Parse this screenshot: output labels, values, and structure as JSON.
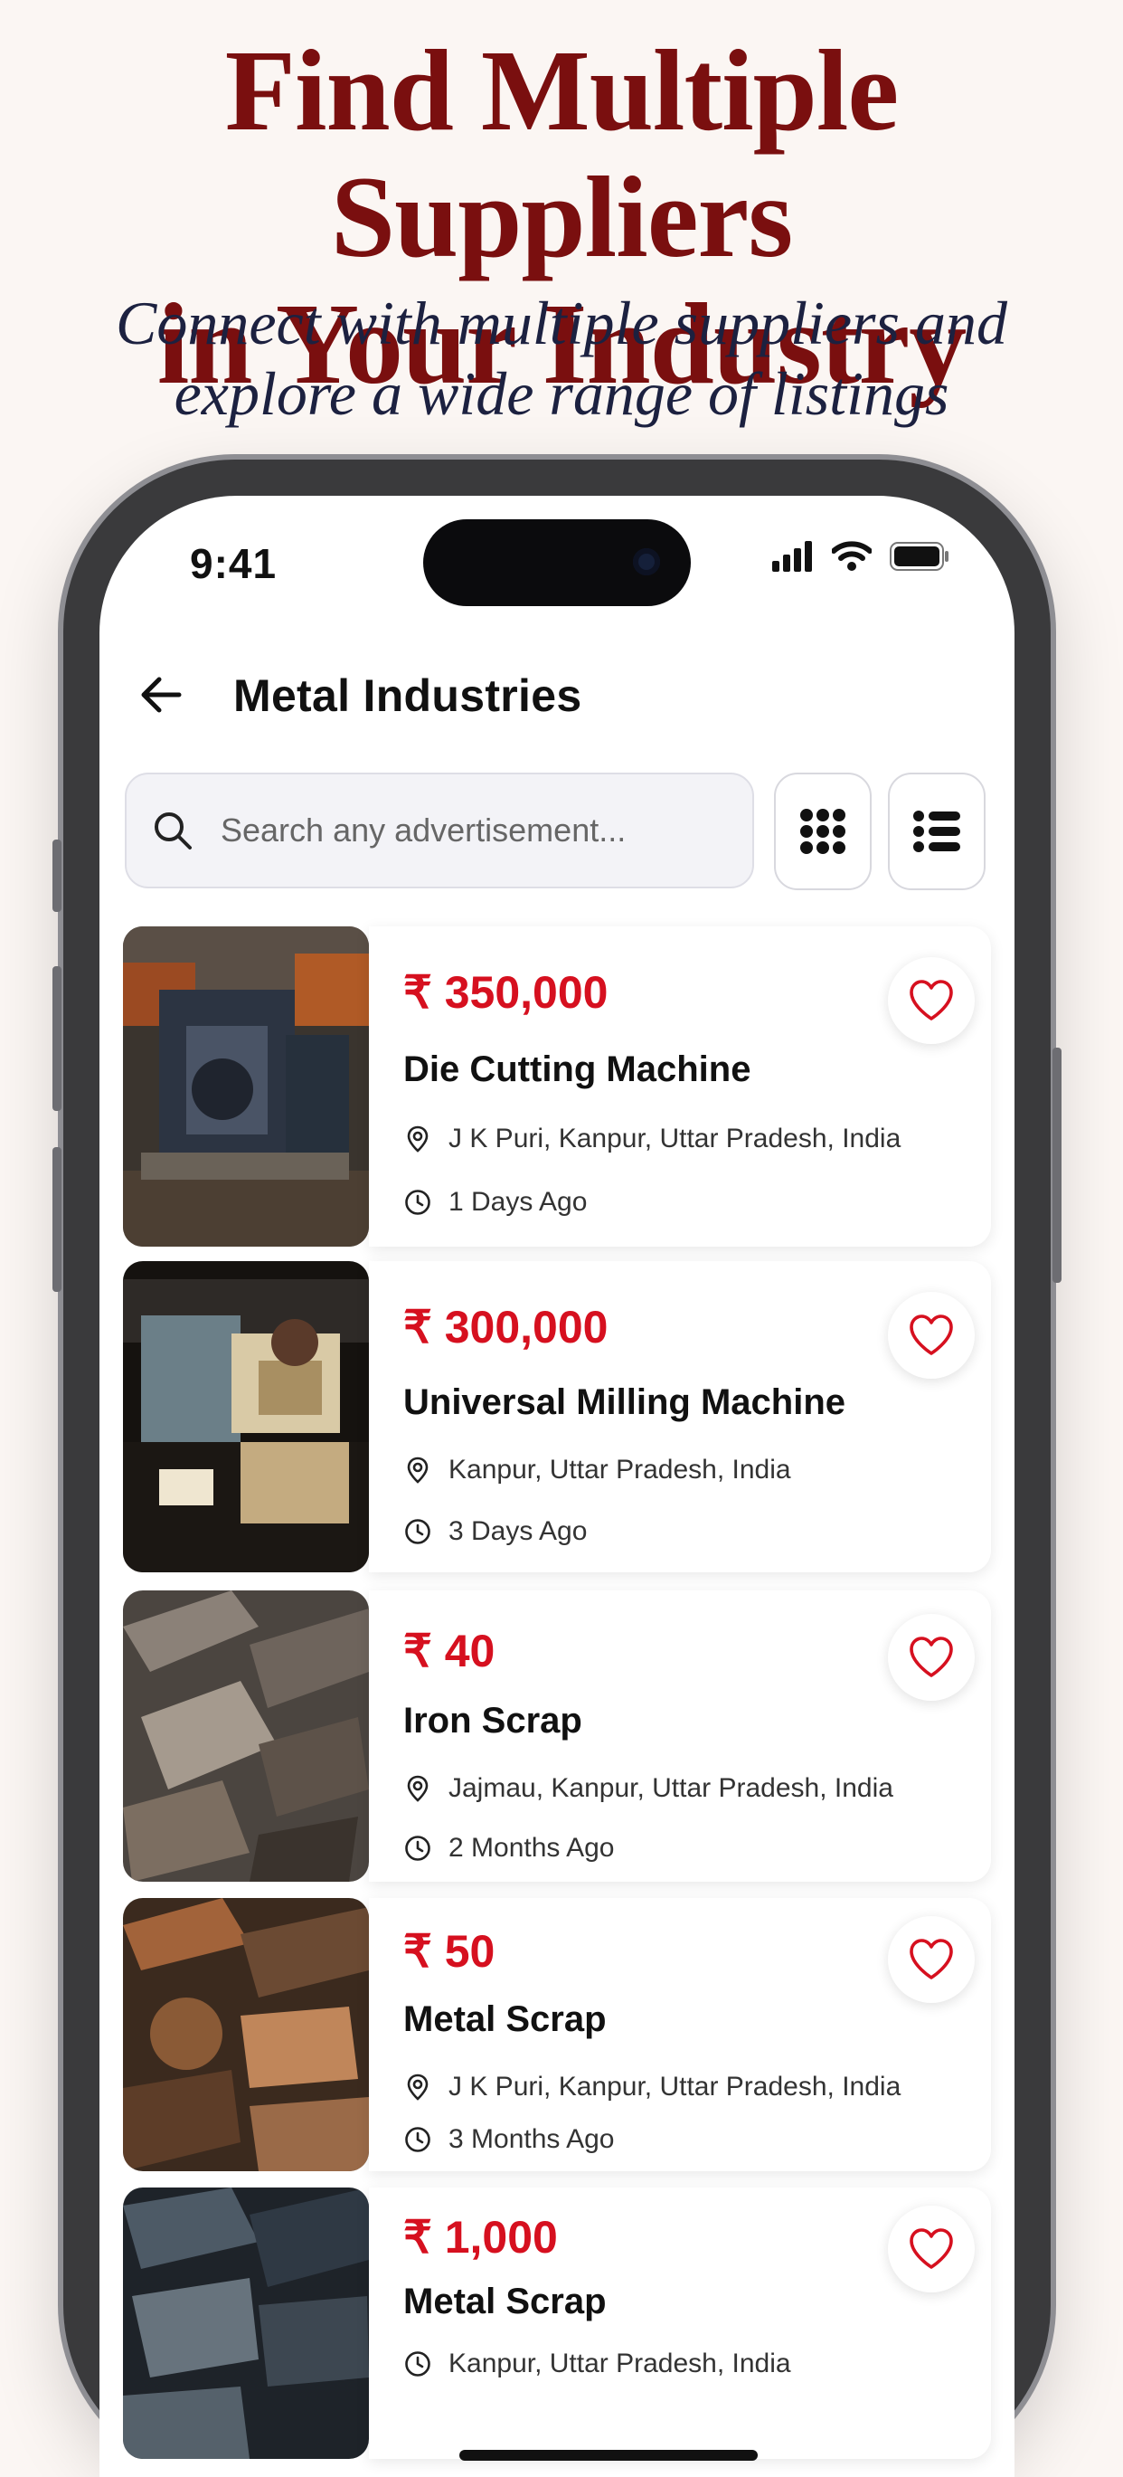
{
  "promo": {
    "headline_line1": "Find Multiple Suppliers",
    "headline_line2": "in Your Industry",
    "sub_line1": "Connect with multiple suppliers and",
    "sub_line2": "explore a wide range of listings"
  },
  "status_bar": {
    "time": "9:41",
    "icons": [
      "signal-icon",
      "wifi-icon",
      "battery-icon"
    ]
  },
  "app_bar": {
    "title": "Metal Industries",
    "back_icon": "arrow-left-icon"
  },
  "search": {
    "placeholder": "Search any advertisement...",
    "value": ""
  },
  "view_toggles": [
    "grid-view-icon",
    "list-view-icon"
  ],
  "colors": {
    "accent": "#d6101f",
    "headline": "#7a0f0f",
    "subheadline": "#1c2140"
  },
  "listings": [
    {
      "price": "₹ 350,000",
      "title": "Die Cutting Machine",
      "location": "J K Puri, Kanpur, Uttar Pradesh, India",
      "posted": "1 Days Ago"
    },
    {
      "price": "₹ 300,000",
      "title": "Universal Milling Machine",
      "location": "Kanpur, Uttar Pradesh, India",
      "posted": "3 Days Ago"
    },
    {
      "price": "₹ 40",
      "title": "Iron Scrap",
      "location": "Jajmau, Kanpur, Uttar Pradesh, India",
      "posted": "2 Months Ago"
    },
    {
      "price": "₹ 50",
      "title": "Metal Scrap",
      "location": "J K Puri, Kanpur, Uttar Pradesh, India",
      "posted": "3 Months Ago"
    },
    {
      "price": "₹ 1,000",
      "title": "Metal Scrap",
      "location": "Kanpur, Uttar Pradesh, India",
      "posted": ""
    }
  ]
}
